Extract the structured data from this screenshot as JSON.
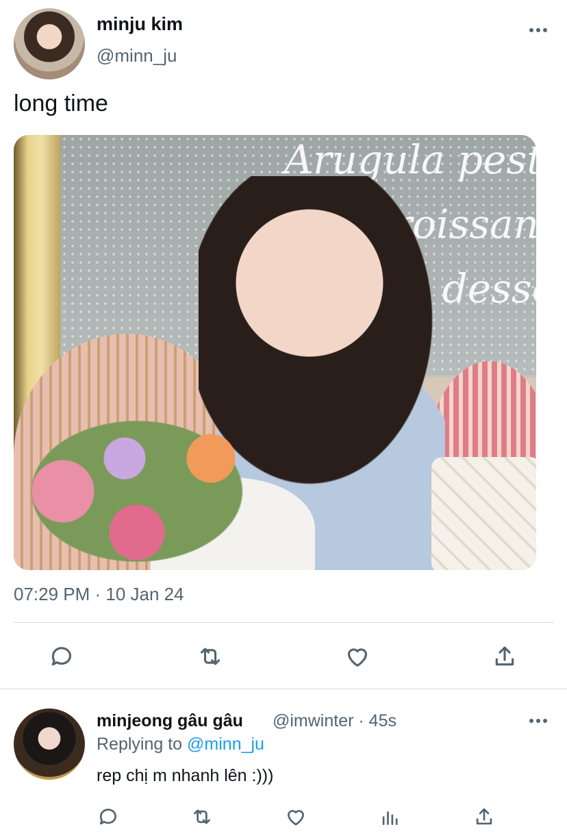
{
  "tweet": {
    "display_name": "minju kim",
    "handle": "@minn_ju",
    "text": "long time",
    "photo_text": [
      "Arugula pest",
      "Croissan",
      "Fruit desse"
    ],
    "timestamp": "07:29 PM · 10 Jan 24",
    "actions": [
      "reply-icon",
      "retweet-icon",
      "like-icon",
      "share-icon"
    ]
  },
  "reply": {
    "display_name": "minjeong gâu gâu",
    "handle_time": "@imwinter · 45s",
    "replying_prefix": "Replying to",
    "replying_mention": "@minn_ju",
    "text": "rep chị m nhanh lên :)))",
    "actions": [
      "reply-icon",
      "retweet-icon",
      "like-icon",
      "analytics-icon",
      "share-icon"
    ]
  },
  "colors": {
    "text": "#0f1419",
    "secondary": "#536471",
    "link": "#1d9bf0",
    "divider": "#cfd9de"
  }
}
